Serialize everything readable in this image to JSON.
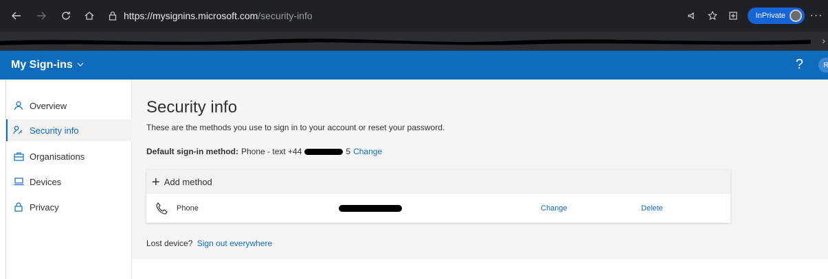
{
  "browser": {
    "url_host": "https://mysignins.microsoft.com",
    "url_path": "/security-info",
    "inprivate_label": "InPrivate",
    "more": "···",
    "fav_more": "›"
  },
  "header": {
    "app_title": "My Sign-ins",
    "help": "?",
    "avatar_initial": "R"
  },
  "sidebar": {
    "items": [
      {
        "label": "Overview",
        "icon": "person-icon",
        "active": false
      },
      {
        "label": "Security info",
        "icon": "key-person-icon",
        "active": true
      },
      {
        "label": "Organisations",
        "icon": "briefcase-icon",
        "active": false
      },
      {
        "label": "Devices",
        "icon": "laptop-icon",
        "active": false
      },
      {
        "label": "Privacy",
        "icon": "lock-icon",
        "active": false
      }
    ]
  },
  "main": {
    "title": "Security info",
    "description": "These are the methods you use to sign in to your account or reset your password.",
    "default_label": "Default sign-in method:",
    "default_value_prefix": "Phone - text +44",
    "default_value_suffix": "5",
    "default_change": "Change",
    "add_method": "Add method",
    "methods": [
      {
        "type": "Phone",
        "change": "Change",
        "delete": "Delete"
      }
    ],
    "lost_device": "Lost device?",
    "sign_out_everywhere": "Sign out everywhere"
  },
  "colors": {
    "accent": "#0f6cbd",
    "browser_bg": "#1e2126",
    "content_bg": "#f5f5f5"
  }
}
